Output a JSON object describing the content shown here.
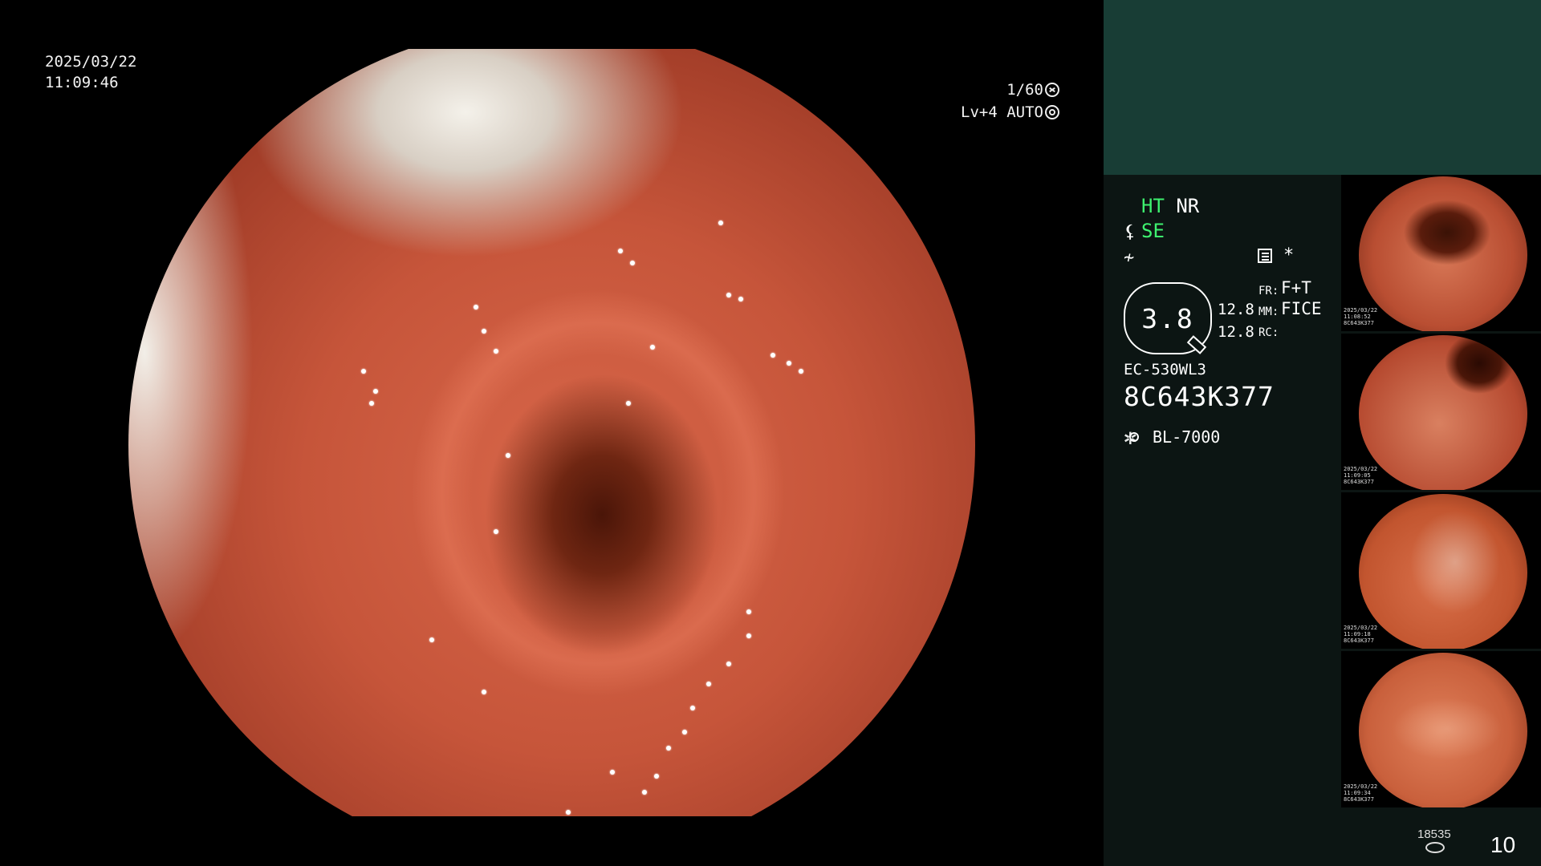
{
  "overlay": {
    "date": "2025/03/22",
    "time": "11:09:46",
    "shutter": "1/60",
    "level": "Lv+4 AUTO"
  },
  "side_panel": {
    "status_row1": [
      "HT",
      "NR"
    ],
    "status_row2": "SE",
    "zoom_value": "3.8",
    "values": [
      "12.8",
      "12.8"
    ],
    "fr_label": "FR:",
    "mm_label": "MM:",
    "rc_label": "RC:",
    "fr_value": "F+T",
    "mm_value": "FICE",
    "scope_model": "EC-530WL3",
    "scope_serial": "8C643K377",
    "light_source": "BL-7000",
    "asterisk": "*"
  },
  "thumbnails": [
    {
      "date": "2025/03/22",
      "time": "11:08:52",
      "serial": "8C643K377"
    },
    {
      "date": "2025/03/22",
      "time": "11:09:05",
      "serial": "8C643K377"
    },
    {
      "date": "2025/03/22",
      "time": "11:09:18",
      "serial": "8C643K377"
    },
    {
      "date": "2025/03/22",
      "time": "11:09:34",
      "serial": "8C643K377"
    }
  ],
  "footer": {
    "storage_count": "18535",
    "capture_count": "10"
  },
  "colors": {
    "panel_bg": "#0c1513",
    "panel_header": "#183d35",
    "status_green": "#3ef16f"
  },
  "icons": [
    "shutter-icon",
    "auto-iris-icon",
    "enhance-icon",
    "filter-icon",
    "settings-box-icon",
    "zoom-pen-icon",
    "light-source-icon",
    "storage-disk-icon"
  ]
}
